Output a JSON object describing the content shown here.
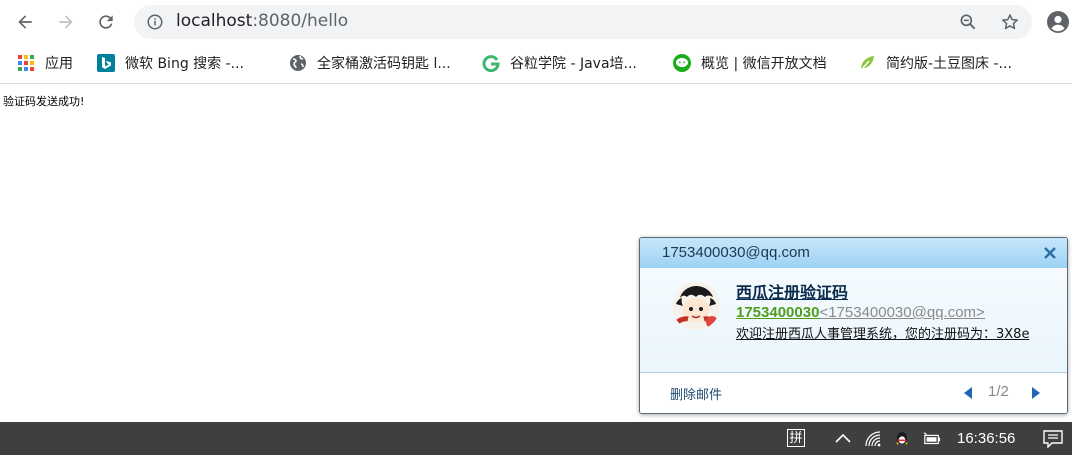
{
  "browser": {
    "url_host": "localhost",
    "url_rest": ":8080/hello"
  },
  "bookmarks": [
    {
      "label": "应用",
      "icon": "apps-grid-icon"
    },
    {
      "label": "微软 Bing 搜索 -...",
      "icon": "bing-icon"
    },
    {
      "label": "全家桶激活码钥匙 l...",
      "icon": "globe-icon"
    },
    {
      "label": "谷粒学院 - Java培...",
      "icon": "guli-icon"
    },
    {
      "label": "概览 | 微信开放文档",
      "icon": "wechat-icon"
    },
    {
      "label": "简约版-土豆图床 -...",
      "icon": "leaf-icon"
    }
  ],
  "page": {
    "message": "验证码发送成功!"
  },
  "notification": {
    "account": "1753400030@qq.com",
    "subject": "西瓜注册验证码",
    "from_name": "1753400030",
    "from_address": "<1753400030@qq.com>",
    "preview": "欢迎注册西瓜人事管理系统，您的注册码为：3X8e",
    "delete_label": "删除邮件",
    "pager": "1/2"
  },
  "taskbar": {
    "ime": "拼",
    "time": "16:36:56"
  },
  "colors": {
    "notification_header": "#9dd2f3",
    "from_name": "#4f9d1f",
    "taskbar": "#3f3f3f"
  }
}
